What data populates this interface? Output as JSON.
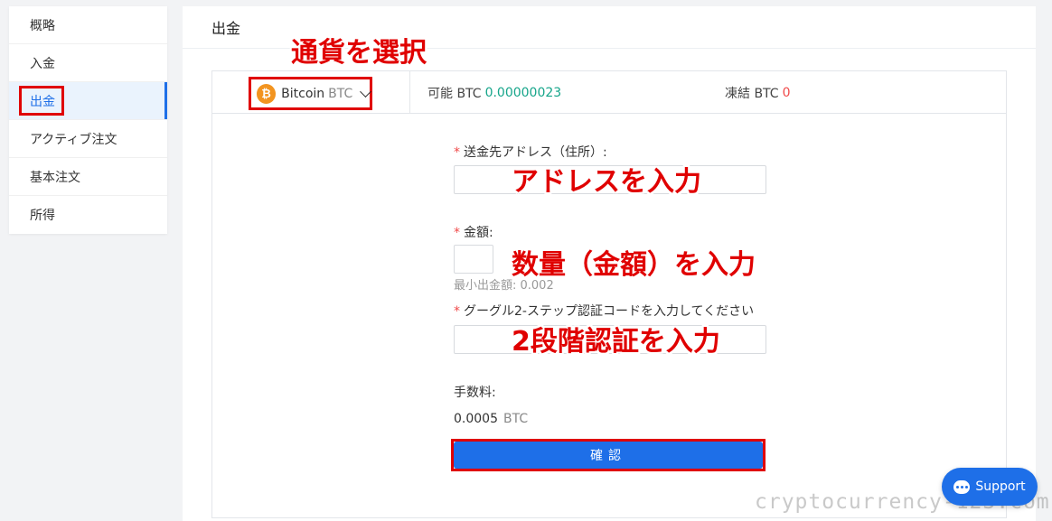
{
  "sidebar": {
    "items": [
      {
        "label": "概略"
      },
      {
        "label": "入金"
      },
      {
        "label": "出金"
      },
      {
        "label": "アクティブ注文"
      },
      {
        "label": "基本注文"
      },
      {
        "label": "所得"
      }
    ]
  },
  "main": {
    "title": "出金",
    "coin": {
      "icon": "₿",
      "name": "Bitcoin",
      "unit": "BTC"
    },
    "available": {
      "label": "可能 BTC",
      "value": "0.00000023"
    },
    "frozen": {
      "label": "凍結 BTC",
      "value": "0"
    },
    "form": {
      "address_label": "送金先アドレス（住所）:",
      "amount_label": "金額:",
      "min_amount": "最小出金額:  0.002",
      "tfa_label": "グーグル2-ステップ認証コードを入力してください",
      "fee_label": "手数料:",
      "fee_value": "0.0005",
      "fee_unit": "BTC",
      "required_mark": "*",
      "confirm_label": "確認"
    }
  },
  "annotations": {
    "select_currency": "通貨を選択",
    "enter_address": "アドレスを入力",
    "enter_amount": "数量（金額）を入力",
    "enter_2fa": "2段階認証を入力"
  },
  "support": {
    "label": "Support"
  },
  "watermark": "cryptocurrency-123.com",
  "colors": {
    "accent": "#1e6fe8",
    "annotation": "#e00000",
    "available_value": "#16a58a",
    "frozen_value": "#f04a4a"
  }
}
